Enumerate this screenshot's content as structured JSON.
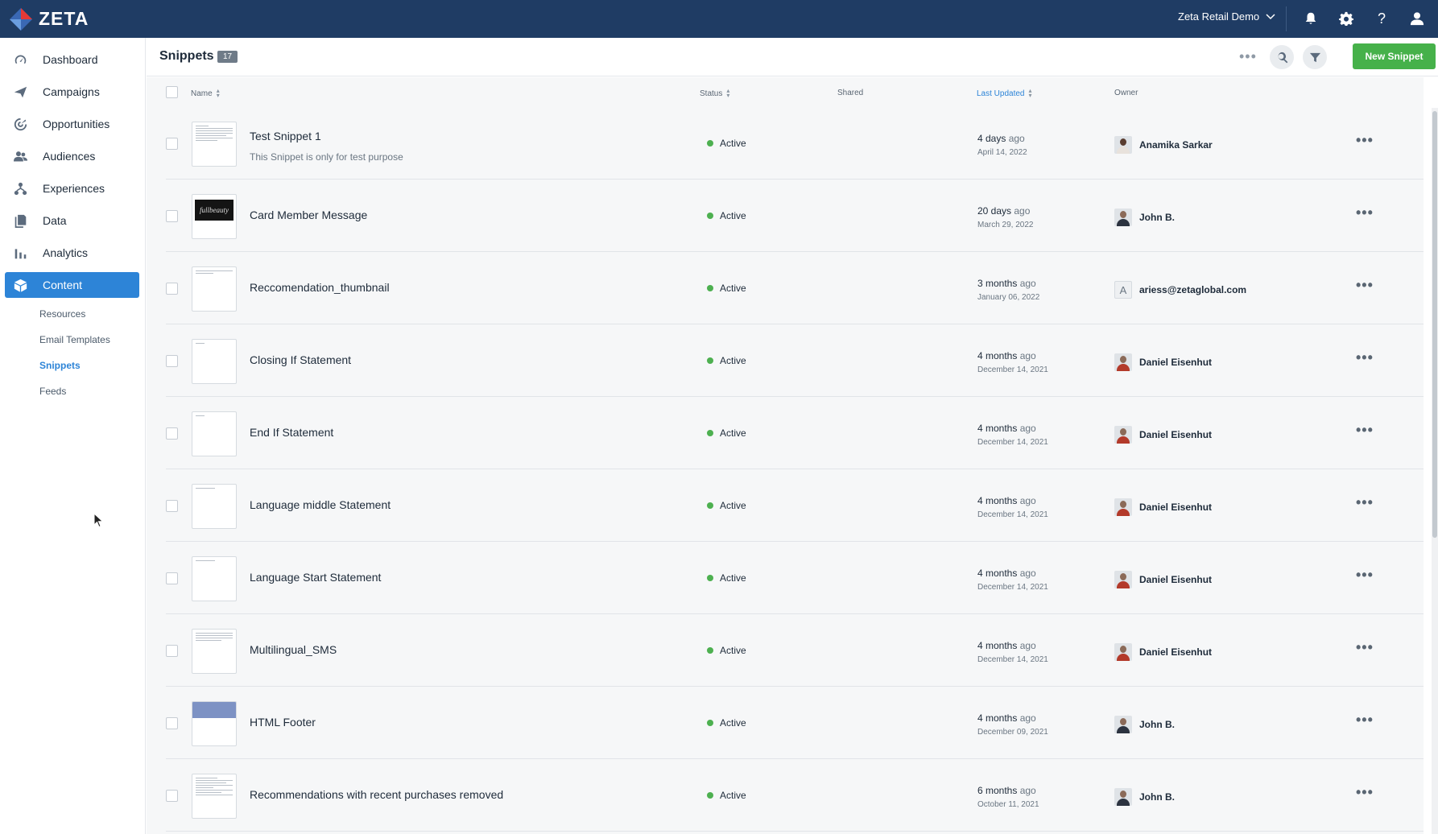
{
  "app": {
    "logo_text": "ZETA",
    "account": "Zeta Retail Demo"
  },
  "sidebar": {
    "items": [
      {
        "label": "Dashboard",
        "icon": "gauge-icon"
      },
      {
        "label": "Campaigns",
        "icon": "paper-plane-icon"
      },
      {
        "label": "Opportunities",
        "icon": "target-icon"
      },
      {
        "label": "Audiences",
        "icon": "people-icon"
      },
      {
        "label": "Experiences",
        "icon": "hierarchy-icon"
      },
      {
        "label": "Data",
        "icon": "files-icon"
      },
      {
        "label": "Analytics",
        "icon": "bar-chart-icon"
      },
      {
        "label": "Content",
        "icon": "box-icon",
        "active": true
      }
    ],
    "subitems": [
      {
        "label": "Resources"
      },
      {
        "label": "Email Templates"
      },
      {
        "label": "Snippets",
        "active": true
      },
      {
        "label": "Feeds"
      }
    ]
  },
  "header": {
    "title": "Snippets",
    "count": "17",
    "more": "•••",
    "new_button": "New Snippet"
  },
  "table": {
    "columns": {
      "name": "Name",
      "status": "Status",
      "shared": "Shared",
      "last_updated": "Last Updated",
      "owner": "Owner"
    },
    "rows": [
      {
        "name": "Test Snippet 1",
        "description": "This Snippet is only for test purpose",
        "status": "Active",
        "updated_value": "4 days",
        "updated_ago": "ago",
        "updated_date": "April 14, 2022",
        "owner": "Anamika Sarkar",
        "more": "•••"
      },
      {
        "name": "Card Member Message",
        "description": "",
        "thumb_text": "fullbeauty",
        "status": "Active",
        "updated_value": "20 days",
        "updated_ago": "ago",
        "updated_date": "March 29, 2022",
        "owner": "John B.",
        "more": "•••"
      },
      {
        "name": "Reccomendation_thumbnail",
        "description": "",
        "status": "Active",
        "updated_value": "3 months",
        "updated_ago": "ago",
        "updated_date": "January 06, 2022",
        "owner": "ariess@zetaglobal.com",
        "owner_initial": "A",
        "more": "•••"
      },
      {
        "name": "Closing If Statement",
        "description": "",
        "status": "Active",
        "updated_value": "4 months",
        "updated_ago": "ago",
        "updated_date": "December 14, 2021",
        "owner": "Daniel Eisenhut",
        "more": "•••"
      },
      {
        "name": "End If Statement",
        "description": "",
        "status": "Active",
        "updated_value": "4 months",
        "updated_ago": "ago",
        "updated_date": "December 14, 2021",
        "owner": "Daniel Eisenhut",
        "more": "•••"
      },
      {
        "name": "Language middle Statement",
        "description": "",
        "status": "Active",
        "updated_value": "4 months",
        "updated_ago": "ago",
        "updated_date": "December 14, 2021",
        "owner": "Daniel Eisenhut",
        "more": "•••"
      },
      {
        "name": "Language Start Statement",
        "description": "",
        "status": "Active",
        "updated_value": "4 months",
        "updated_ago": "ago",
        "updated_date": "December 14, 2021",
        "owner": "Daniel Eisenhut",
        "more": "•••"
      },
      {
        "name": "Multilingual_SMS",
        "description": "",
        "status": "Active",
        "updated_value": "4 months",
        "updated_ago": "ago",
        "updated_date": "December 14, 2021",
        "owner": "Daniel Eisenhut",
        "more": "•••"
      },
      {
        "name": "HTML Footer",
        "description": "",
        "status": "Active",
        "updated_value": "4 months",
        "updated_ago": "ago",
        "updated_date": "December 09, 2021",
        "owner": "John B.",
        "more": "•••"
      },
      {
        "name": "Recommendations with recent purchases removed",
        "description": "",
        "status": "Active",
        "updated_value": "6 months",
        "updated_ago": "ago",
        "updated_date": "October 11, 2021",
        "owner": "John B.",
        "more": "•••"
      }
    ]
  },
  "colors": {
    "topbar": "#1f3c64",
    "accent": "#2d84d7",
    "primary_button": "#46b14a",
    "status_active": "#4db050"
  }
}
